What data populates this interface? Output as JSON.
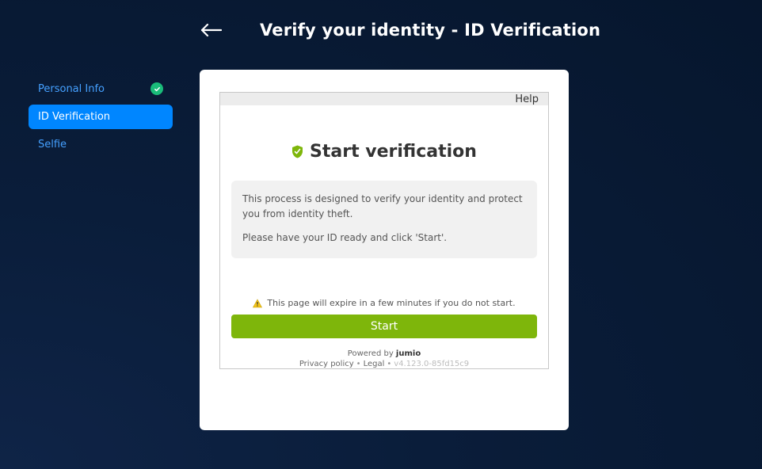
{
  "header": {
    "title": "Verify your identity - ID Verification"
  },
  "sidebar": {
    "items": [
      {
        "label": "Personal Info",
        "state": "done"
      },
      {
        "label": "ID Verification",
        "state": "active"
      },
      {
        "label": "Selfie",
        "state": "pending"
      }
    ]
  },
  "iframe": {
    "help_label": "Help",
    "title": "Start verification",
    "desc_line1": "This process is designed to verify your identity and protect you from identity theft.",
    "desc_line2": "Please have your ID ready and click 'Start'.",
    "expire_text": "This page will expire in a few minutes if you do not start.",
    "start_label": "Start",
    "powered_prefix": "Powered by ",
    "powered_brand": "jumio",
    "privacy_label": "Privacy policy",
    "legal_label": "Legal",
    "version": "v4.123.0-85fd15c9"
  },
  "colors": {
    "accent": "#0086ff",
    "success": "#1abc7a",
    "start_btn": "#7eb60b"
  }
}
